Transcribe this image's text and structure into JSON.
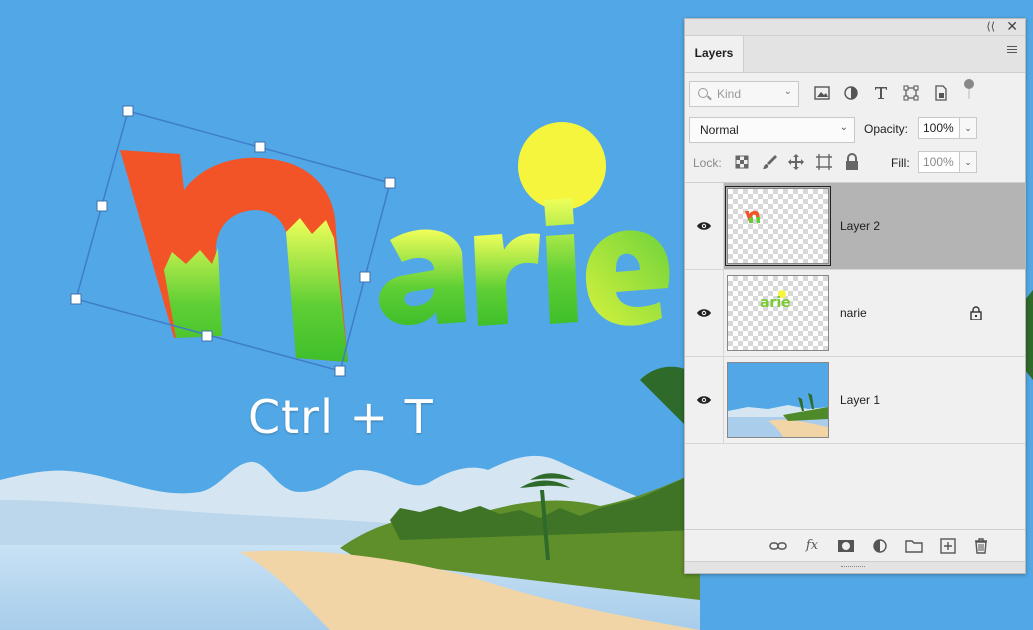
{
  "canvas": {
    "logo_text": "narie",
    "shortcut_text": "Ctrl + T",
    "colors": {
      "sky": "#52a8e6",
      "sun": "#f6f53e",
      "sea": "#bcd9ef",
      "sand": "#f1d5a7",
      "mountains": "#d5e6f2",
      "logo_orange": "#f25427",
      "logo_green": "#48c42e"
    }
  },
  "panel": {
    "tab_label": "Layers",
    "filter": {
      "kind_placeholder": "Kind"
    },
    "blend_mode": "Normal",
    "opacity_label": "Opacity:",
    "opacity_value": "100%",
    "lock_label": "Lock:",
    "fill_label": "Fill:",
    "fill_value": "100%",
    "layers": [
      {
        "name": "Layer 2",
        "visible": true,
        "selected": true,
        "locked": false
      },
      {
        "name": "narie",
        "visible": true,
        "selected": false,
        "locked": true
      },
      {
        "name": "Layer 1",
        "visible": true,
        "selected": false,
        "locked": false
      }
    ],
    "bottom_icons": [
      "link-icon",
      "fx-icon",
      "mask-icon",
      "adjustment-icon",
      "folder-icon",
      "new-layer-icon",
      "trash-icon"
    ],
    "fx_label": "fx"
  }
}
